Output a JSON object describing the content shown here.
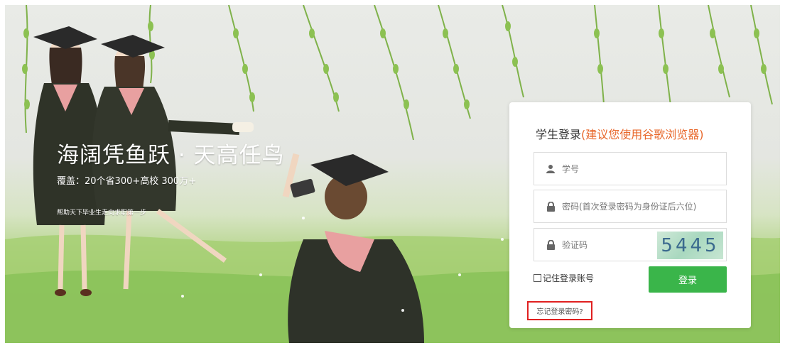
{
  "hero": {
    "title": "海阔凭鱼跃 · 天高任鸟",
    "subtitle": "覆盖：20个省300+高校  300万+",
    "small_text": "帮助天下毕业生走向求职第一步"
  },
  "login": {
    "title": "学生登录",
    "title_hint": "(建议您使用谷歌浏览器)",
    "username_placeholder": "学号",
    "password_placeholder": "密码(首次登录密码为身份证后六位)",
    "captcha_placeholder": "验证码",
    "captcha_code": "5445",
    "remember_label": "记住登录账号",
    "login_button": "登录",
    "forgot_password": "忘记登录密码?"
  },
  "colors": {
    "accent_green": "#3ab54a",
    "hint_orange": "#e8672a",
    "highlight_red": "#e02020"
  },
  "icons": {
    "username": "user-icon",
    "password": "lock-icon",
    "captcha": "lock-icon"
  }
}
